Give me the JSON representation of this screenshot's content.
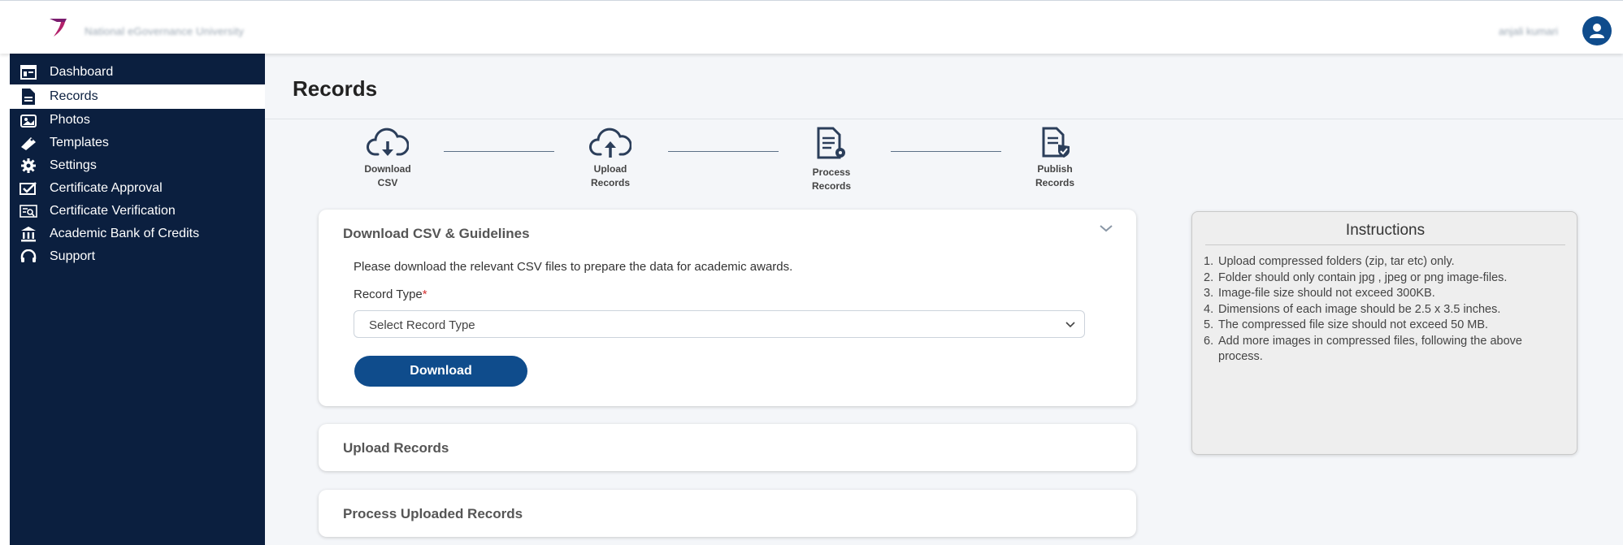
{
  "header": {
    "org_name": "National eGovernance University",
    "user_name": "anjali kumari",
    "logo_icon": "brand-logo-icon",
    "avatar_icon": "user-avatar-icon"
  },
  "sidebar": {
    "items": [
      {
        "label": "Dashboard",
        "icon": "dashboard-icon",
        "active": false
      },
      {
        "label": "Records",
        "icon": "records-icon",
        "active": true
      },
      {
        "label": "Photos",
        "icon": "photos-icon",
        "active": false
      },
      {
        "label": "Templates",
        "icon": "templates-icon",
        "active": false
      },
      {
        "label": "Settings",
        "icon": "settings-icon",
        "active": false
      },
      {
        "label": "Certificate Approval",
        "icon": "certificate-approval-icon",
        "active": false
      },
      {
        "label": "Certificate Verification",
        "icon": "certificate-verification-icon",
        "active": false
      },
      {
        "label": "Academic Bank of Credits",
        "icon": "bank-icon",
        "active": false
      },
      {
        "label": "Support",
        "icon": "headset-icon",
        "active": false
      }
    ]
  },
  "main": {
    "title": "Records",
    "steps": [
      {
        "line1": "Download",
        "line2": "CSV",
        "icon": "cloud-download-icon"
      },
      {
        "line1": "Upload",
        "line2": "Records",
        "icon": "cloud-upload-icon"
      },
      {
        "line1": "Process",
        "line2": "Records",
        "icon": "process-document-icon"
      },
      {
        "line1": "Publish",
        "line2": "Records",
        "icon": "publish-document-icon"
      }
    ],
    "download_card": {
      "title": "Download CSV & Guidelines",
      "description": "Please download the relevant CSV files to prepare the data for academic awards.",
      "record_type_label": "Record Type",
      "required_mark": "*",
      "select_value": "Select Record Type",
      "download_label": "Download"
    },
    "upload_card": {
      "title": "Upload Records"
    },
    "process_card": {
      "title": "Process Uploaded Records"
    }
  },
  "instructions": {
    "title": "Instructions",
    "items": [
      {
        "n": "1.",
        "text": "Upload compressed folders (zip, tar etc) only."
      },
      {
        "n": "2.",
        "text": "Folder should only contain jpg , jpeg or png image-files."
      },
      {
        "n": "3.",
        "text": "Image-file size should not exceed 300KB."
      },
      {
        "n": "4.",
        "text": "Dimensions of each image should be 2.5 x 3.5 inches."
      },
      {
        "n": "5.",
        "text": "The compressed file size should not exceed 50 MB."
      },
      {
        "n": "6.",
        "text": "Add more images in compressed files, following the above process."
      }
    ]
  },
  "colors": {
    "sidebar_bg": "#0b1f3f",
    "primary": "#0f4c8c",
    "main_bg": "#f4f6f9",
    "required": "#d43232"
  }
}
